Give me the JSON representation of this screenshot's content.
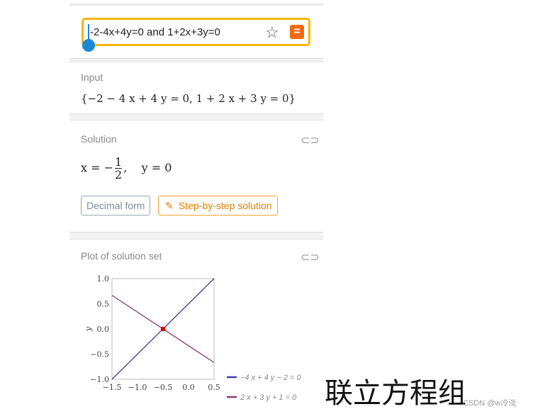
{
  "query": {
    "value": "-2-4x+4y=0 and 1+2x+3y=0",
    "star_icon": "star-icon",
    "submit_icon": "equals-icon"
  },
  "input": {
    "label": "Input",
    "expression": "{−2 − 4 x + 4 y = 0, 1 + 2 x + 3 y = 0}"
  },
  "solution": {
    "label": "Solution",
    "x_lhs": "x = −",
    "x_num": "1",
    "x_den": "2",
    "y_text": ",    y = 0",
    "decimal_button": "Decimal form",
    "step_button": "Step-by-step solution",
    "accent": "#f08c00"
  },
  "plot": {
    "label": "Plot of solution set"
  },
  "chart_data": {
    "type": "line",
    "xlim": [
      -1.5,
      0.5
    ],
    "ylim": [
      -1,
      1
    ],
    "xticks": [
      "−1.5",
      "−1.0",
      "−0.5",
      "0.0",
      "0.5"
    ],
    "yticks": [
      "−1.0",
      "−0.5",
      "0.0",
      "0.5",
      "1.0"
    ],
    "ylabel": "y",
    "series": [
      {
        "name": "−4 x + 4 y − 2 = 0",
        "color": "#3b3f9a",
        "x": [
          -1.5,
          0.5
        ],
        "y": [
          -1,
          1
        ]
      },
      {
        "name": "2 x + 3 y + 1 = 0",
        "color": "#8e3a6a",
        "x": [
          -1.5,
          0.5
        ],
        "y": [
          0.667,
          -0.667
        ]
      }
    ],
    "points": [
      {
        "x": -0.5,
        "y": 0,
        "color": "#e00000"
      }
    ]
  },
  "overlay_text": "联立方程组",
  "watermark": "CSDN @w冷淡"
}
